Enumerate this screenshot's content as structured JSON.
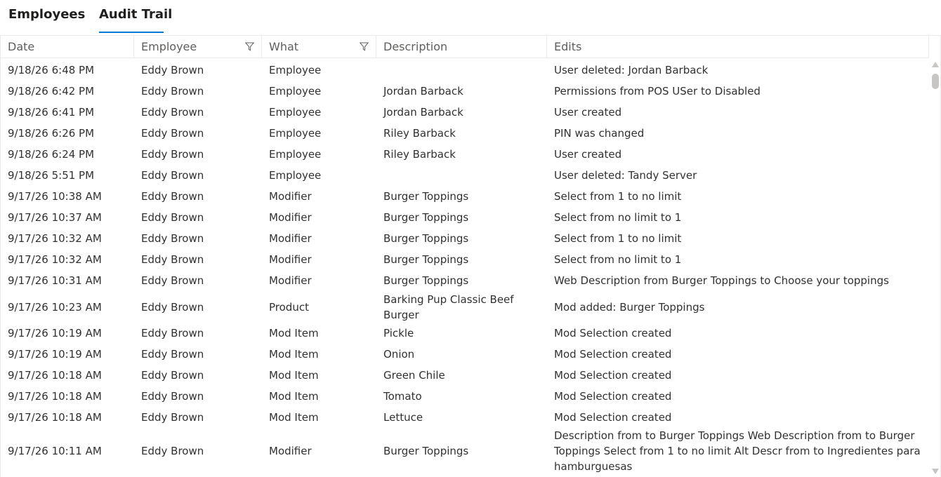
{
  "tabs": [
    {
      "label": "Employees",
      "active": false
    },
    {
      "label": "Audit Trail",
      "active": true
    }
  ],
  "colors": {
    "accent": "#0078d4",
    "border": "#edebe9",
    "header_text": "#605e5c"
  },
  "columns": {
    "date": "Date",
    "employee": "Employee",
    "what": "What",
    "description": "Description",
    "edits": "Edits"
  },
  "filterable_columns": [
    "Employee",
    "What"
  ],
  "rows": [
    {
      "date": "9/18/26 6:48 PM",
      "employee": "Eddy Brown",
      "what": "Employee",
      "description": "",
      "edits": "User deleted: Jordan Barback"
    },
    {
      "date": "9/18/26 6:42 PM",
      "employee": "Eddy Brown",
      "what": "Employee",
      "description": "Jordan Barback",
      "edits": "Permissions from POS USer to Disabled"
    },
    {
      "date": "9/18/26 6:41 PM",
      "employee": "Eddy Brown",
      "what": "Employee",
      "description": "Jordan Barback",
      "edits": "User created"
    },
    {
      "date": "9/18/26 6:26 PM",
      "employee": "Eddy Brown",
      "what": "Employee",
      "description": "Riley Barback",
      "edits": "PIN was changed"
    },
    {
      "date": "9/18/26 6:24 PM",
      "employee": "Eddy Brown",
      "what": "Employee",
      "description": "Riley Barback",
      "edits": "User created"
    },
    {
      "date": "9/18/26 5:51 PM",
      "employee": "Eddy Brown",
      "what": "Employee",
      "description": "",
      "edits": "User deleted: Tandy Server"
    },
    {
      "date": "9/17/26 10:38 AM",
      "employee": "Eddy Brown",
      "what": "Modifier",
      "description": "Burger Toppings",
      "edits": "Select from 1 to no limit"
    },
    {
      "date": "9/17/26 10:37 AM",
      "employee": "Eddy Brown",
      "what": "Modifier",
      "description": "Burger Toppings",
      "edits": "Select from no limit to 1"
    },
    {
      "date": "9/17/26 10:32 AM",
      "employee": "Eddy Brown",
      "what": "Modifier",
      "description": "Burger Toppings",
      "edits": "Select from 1 to no limit"
    },
    {
      "date": "9/17/26 10:32 AM",
      "employee": "Eddy Brown",
      "what": "Modifier",
      "description": "Burger Toppings",
      "edits": "Select from no limit to 1"
    },
    {
      "date": "9/17/26 10:31 AM",
      "employee": "Eddy Brown",
      "what": "Modifier",
      "description": "Burger Toppings",
      "edits": "Web Description from Burger Toppings to Choose your toppings"
    },
    {
      "date": "9/17/26 10:23 AM",
      "employee": "Eddy Brown",
      "what": "Product",
      "description": "Barking Pup Classic Beef Burger",
      "edits": "Mod added: Burger Toppings"
    },
    {
      "date": "9/17/26 10:19 AM",
      "employee": "Eddy Brown",
      "what": "Mod Item",
      "description": "Pickle",
      "edits": "Mod Selection created"
    },
    {
      "date": "9/17/26 10:19 AM",
      "employee": "Eddy Brown",
      "what": "Mod Item",
      "description": "Onion",
      "edits": "Mod Selection created"
    },
    {
      "date": "9/17/26 10:18 AM",
      "employee": "Eddy Brown",
      "what": "Mod Item",
      "description": "Green Chile",
      "edits": "Mod Selection created"
    },
    {
      "date": "9/17/26 10:18 AM",
      "employee": "Eddy Brown",
      "what": "Mod Item",
      "description": "Tomato",
      "edits": "Mod Selection created"
    },
    {
      "date": "9/17/26 10:18 AM",
      "employee": "Eddy Brown",
      "what": "Mod Item",
      "description": "Lettuce",
      "edits": "Mod Selection created"
    },
    {
      "date": "9/17/26 10:11 AM",
      "employee": "Eddy Brown",
      "what": "Modifier",
      "description": "Burger Toppings",
      "edits": "Description from to Burger Toppings Web Description from to Burger Toppings Select from 1 to no limit Alt Descr from to Ingredientes para hamburguesas"
    }
  ]
}
